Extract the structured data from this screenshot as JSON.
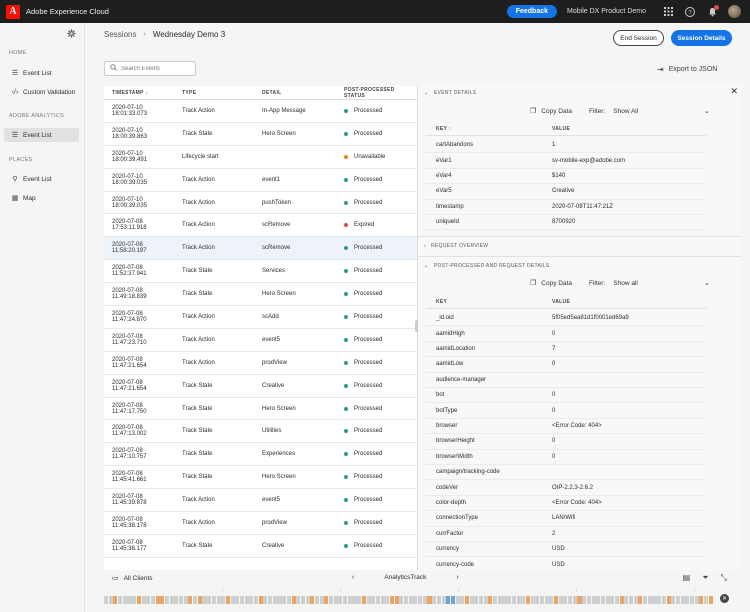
{
  "topbar": {
    "brand": "Adobe Experience Cloud",
    "feedback_label": "Feedback",
    "org_name": "Mobile DX Product Demo",
    "icons": [
      "apps-grid-icon",
      "help-icon",
      "bell-icon"
    ]
  },
  "nav": {
    "sections": [
      {
        "title": "HOME",
        "items": [
          {
            "label": "Event List",
            "icon": "list-icon",
            "active": false
          },
          {
            "label": "Custom Validation",
            "icon": "code-icon",
            "active": false
          }
        ]
      },
      {
        "title": "ADOBE ANALYTICS",
        "items": [
          {
            "label": "Event List",
            "icon": "list-icon",
            "active": true
          }
        ]
      },
      {
        "title": "PLACES",
        "items": [
          {
            "label": "Event List",
            "icon": "pin-icon",
            "active": false
          },
          {
            "label": "Map",
            "icon": "map-icon",
            "active": false
          }
        ]
      }
    ]
  },
  "breadcrumb": {
    "root": "Sessions",
    "current": "Wednesday Demo 3"
  },
  "actions": {
    "end_session": "End Session",
    "session_details": "Session Details"
  },
  "search": {
    "placeholder": "Search Events"
  },
  "export_label": "Export to JSON",
  "table": {
    "columns": [
      "TIMESTAMP",
      "TYPE",
      "DETAIL",
      "POST-PROCESSED STATUS"
    ],
    "rows": [
      {
        "ts": "2020-07-10 18:01:33.073",
        "type": "Track Action",
        "detail": "In-App Message",
        "status": "Processed",
        "color": "#2d9d78"
      },
      {
        "ts": "2020-07-10 18:00:39.863",
        "type": "Track State",
        "detail": "Hero Screen",
        "status": "Processed",
        "color": "#2d9d78"
      },
      {
        "ts": "2020-07-10 18:00:39.491",
        "type": "Lifecycle start",
        "detail": "",
        "status": "Unavailable",
        "color": "#e68619"
      },
      {
        "ts": "2020-07-10 18:00:39.035",
        "type": "Track Action",
        "detail": "event1",
        "status": "Processed",
        "color": "#2d9d78"
      },
      {
        "ts": "2020-07-10 18:00:39.035",
        "type": "Track Action",
        "detail": "pushToken",
        "status": "Processed",
        "color": "#2d9d78"
      },
      {
        "ts": "2020-07-08 17:53:11.918",
        "type": "Track Action",
        "detail": "scRemove",
        "status": "Expired",
        "color": "#e34850"
      },
      {
        "ts": "2020-07-08 11:58:20.197",
        "type": "Track Action",
        "detail": "scRemove",
        "status": "Processed",
        "color": "#2d9d78"
      },
      {
        "ts": "2020-07-08 11:52:37.941",
        "type": "Track State",
        "detail": "Services",
        "status": "Processed",
        "color": "#2d9d78"
      },
      {
        "ts": "2020-07-08 11:49:18.839",
        "type": "Track State",
        "detail": "Hero Screen",
        "status": "Processed",
        "color": "#2d9d78"
      },
      {
        "ts": "2020-07-08 11:47:24.870",
        "type": "Track Action",
        "detail": "scAdd",
        "status": "Processed",
        "color": "#2d9d78"
      },
      {
        "ts": "2020-07-08 11:47:23.710",
        "type": "Track Action",
        "detail": "event5",
        "status": "Processed",
        "color": "#2d9d78"
      },
      {
        "ts": "2020-07-08 11:47:21.654",
        "type": "Track Action",
        "detail": "prodView",
        "status": "Processed",
        "color": "#2d9d78"
      },
      {
        "ts": "2020-07-08 11:47:21.654",
        "type": "Track State",
        "detail": "Creative",
        "status": "Processed",
        "color": "#2d9d78"
      },
      {
        "ts": "2020-07-08 11:47:17.750",
        "type": "Track State",
        "detail": "Hero Screen",
        "status": "Processed",
        "color": "#2d9d78"
      },
      {
        "ts": "2020-07-08 11:47:13.002",
        "type": "Track State",
        "detail": "Utilities",
        "status": "Processed",
        "color": "#2d9d78"
      },
      {
        "ts": "2020-07-08 11:47:10.757",
        "type": "Track State",
        "detail": "Experiences",
        "status": "Processed",
        "color": "#2d9d78"
      },
      {
        "ts": "2020-07-08 11:45:41.661",
        "type": "Track State",
        "detail": "Hero Screen",
        "status": "Processed",
        "color": "#2d9d78"
      },
      {
        "ts": "2020-07-08 11:45:39.878",
        "type": "Track Action",
        "detail": "event5",
        "status": "Processed",
        "color": "#2d9d78"
      },
      {
        "ts": "2020-07-08 11:45:38.178",
        "type": "Track Action",
        "detail": "prodView",
        "status": "Processed",
        "color": "#2d9d78"
      },
      {
        "ts": "2020-07-08 11:45:38.177",
        "type": "Track State",
        "detail": "Creative",
        "status": "Processed",
        "color": "#2d9d78"
      }
    ]
  },
  "detail": {
    "event_details_title": "EVENT DETAILS",
    "request_overview_title": "REQUEST OVERVIEW",
    "postprocessed_title": "POST-PROCESSED AND REQUEST DETAILS",
    "copy_label": "Copy Data",
    "filter_label": "Filter:",
    "filter_value": "Show All",
    "filter_value_2": "Show all",
    "key_header": "KEY",
    "value_header": "VALUE",
    "event_kv": [
      {
        "k": "cartAbandons",
        "v": "1"
      },
      {
        "k": "eVar1",
        "v": "sv-mobile-exp@adobe.com"
      },
      {
        "k": "eVar4",
        "v": "$140"
      },
      {
        "k": "eVar5",
        "v": "Creative"
      },
      {
        "k": "timestamp",
        "v": "2020-07-08T11:47:21Z"
      },
      {
        "k": "uniqueId",
        "v": "8700920"
      }
    ],
    "post_kv": [
      {
        "k": "_id.oid",
        "v": "5f05ed5ea81d1f0001ed69a9"
      },
      {
        "k": "aamidHigh",
        "v": "0"
      },
      {
        "k": "aamidLocation",
        "v": "7"
      },
      {
        "k": "aamidLow",
        "v": "0"
      },
      {
        "k": "audience-manager",
        "v": ""
      },
      {
        "k": "bot",
        "v": "0"
      },
      {
        "k": "botType",
        "v": "0"
      },
      {
        "k": "browser",
        "v": "<Error Code: 404>"
      },
      {
        "k": "browserHeight",
        "v": "0"
      },
      {
        "k": "browserWidth",
        "v": "0"
      },
      {
        "k": "campaign/tracking-code",
        "v": ""
      },
      {
        "k": "codeVer",
        "v": "OIP-2.2.3-2.6.2"
      },
      {
        "k": "color-depth",
        "v": "<Error Code: 404>"
      },
      {
        "k": "connectionType",
        "v": "LAN/Wifi"
      },
      {
        "k": "currFactor",
        "v": "2"
      },
      {
        "k": "currency",
        "v": "USD"
      },
      {
        "k": "currency-code",
        "v": "USD"
      }
    ]
  },
  "bottom": {
    "clients_label": "All Clients",
    "track_label": "AnalyticsTrack"
  }
}
